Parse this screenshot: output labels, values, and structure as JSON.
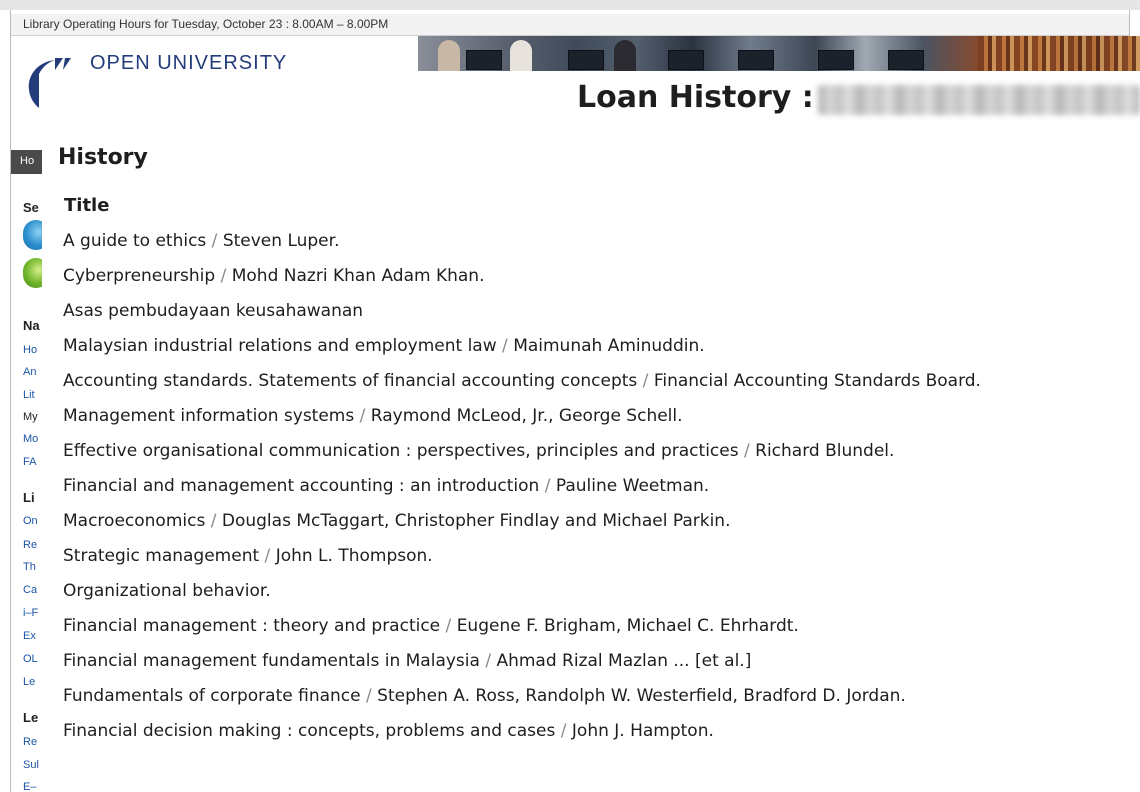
{
  "header": {
    "hours_text": "Library Operating Hours for Tuesday, October 23 : 8.00AM – 8.00PM",
    "logo_text": "OPEN UNIVERSITY"
  },
  "sidebar": {
    "tab_label": "Ho",
    "section_search": "Se",
    "section_nav": "Na",
    "nav_links": [
      "Ho",
      "An",
      "Lit",
      "My",
      "Mo",
      "FA"
    ],
    "section_library": "Li",
    "library_links": [
      "On",
      "Re",
      "Th",
      "Ca",
      "i–F",
      "Ex",
      "OL",
      "Le"
    ],
    "section_learning": "Le",
    "learning_links": [
      "Re",
      "Sul",
      "E–"
    ]
  },
  "panel": {
    "loan_title": "Loan History :",
    "history_heading": "History",
    "column_title": "Title",
    "separator": " / "
  },
  "loans": [
    {
      "title": "A guide to ethics",
      "author": "Steven Luper."
    },
    {
      "title": "Cyberpreneurship",
      "author": "Mohd Nazri Khan Adam Khan."
    },
    {
      "title": "Asas pembudayaan keusahawanan",
      "author": ""
    },
    {
      "title": "Malaysian industrial relations and employment law",
      "author": "Maimunah Aminuddin."
    },
    {
      "title": "Accounting standards. Statements of financial accounting concepts",
      "author": "Financial Accounting Standards Board."
    },
    {
      "title": "Management information systems",
      "author": "Raymond McLeod, Jr., George Schell."
    },
    {
      "title": "Effective organisational communication : perspectives, principles and practices",
      "author": "Richard Blundel."
    },
    {
      "title": "Financial and management accounting : an introduction",
      "author": "Pauline Weetman."
    },
    {
      "title": "Macroeconomics",
      "author": "Douglas McTaggart, Christopher Findlay and Michael Parkin."
    },
    {
      "title": "Strategic management",
      "author": "John L. Thompson."
    },
    {
      "title": "Organizational behavior.",
      "author": ""
    },
    {
      "title": "Financial management : theory and practice",
      "author": "Eugene F. Brigham, Michael C. Ehrhardt."
    },
    {
      "title": "Financial management fundamentals in Malaysia",
      "author": "Ahmad Rizal Mazlan ... [et al.]"
    },
    {
      "title": "Fundamentals of corporate finance",
      "author": "Stephen A. Ross, Randolph W. Westerfield, Bradford D. Jordan."
    },
    {
      "title": "Financial decision making : concepts, problems and cases",
      "author": "John J. Hampton."
    }
  ],
  "colors": {
    "logo_blue": "#233d7a",
    "link_blue": "#1a55a8",
    "text": "#1e1e1e",
    "separator_gray": "#8a8a8a"
  }
}
